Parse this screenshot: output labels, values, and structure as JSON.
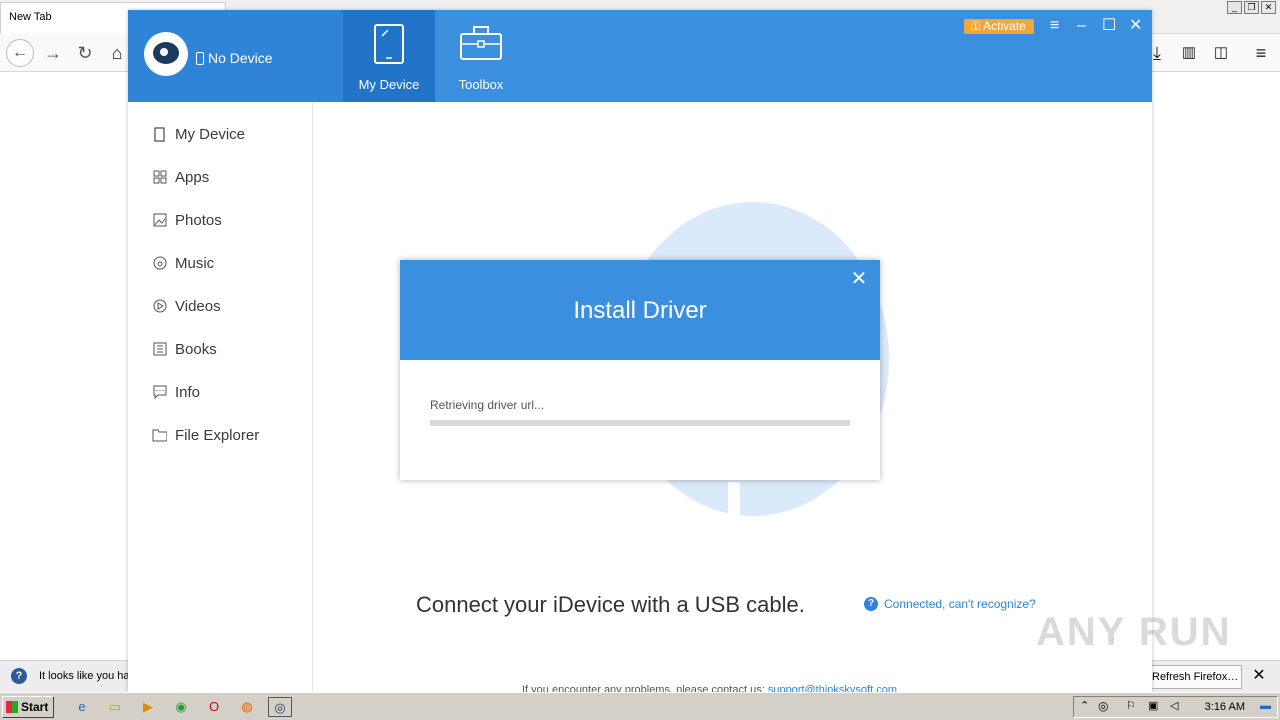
{
  "browser": {
    "tab_title": "New Tab",
    "notification_text": "It looks like you ha",
    "notification_button": "Refresh Firefox…"
  },
  "app": {
    "status_label": "No Device",
    "nav_tabs": [
      {
        "label": "My Device",
        "icon": "phone-icon",
        "active": true
      },
      {
        "label": "Toolbox",
        "icon": "toolbox-icon",
        "active": false
      }
    ],
    "activate_label": "Activate",
    "sidebar": {
      "items": [
        {
          "label": "My Device",
          "icon": "device-icon"
        },
        {
          "label": "Apps",
          "icon": "apps-grid-icon"
        },
        {
          "label": "Photos",
          "icon": "photo-icon"
        },
        {
          "label": "Music",
          "icon": "music-icon"
        },
        {
          "label": "Videos",
          "icon": "video-icon"
        },
        {
          "label": "Books",
          "icon": "book-icon"
        },
        {
          "label": "Info",
          "icon": "info-chat-icon"
        },
        {
          "label": "File Explorer",
          "icon": "folder-icon"
        }
      ]
    },
    "main": {
      "connect_text": "Connect your iDevice with a USB cable.",
      "help_link": "Connected, can't recognize?",
      "footer_text": "If you encounter any problems, please contact us:",
      "footer_email": "support@thinkskysoft.com"
    },
    "colors": {
      "header_blue": "#3b8fdf",
      "active_tab": "#2274c8",
      "activate_orange": "#f2a838"
    }
  },
  "dialog": {
    "title": "Install Driver",
    "status": "Retrieving driver url...",
    "progress": 0
  },
  "taskbar": {
    "start_label": "Start",
    "time": "3:16 AM"
  },
  "watermark": "ANY RUN"
}
